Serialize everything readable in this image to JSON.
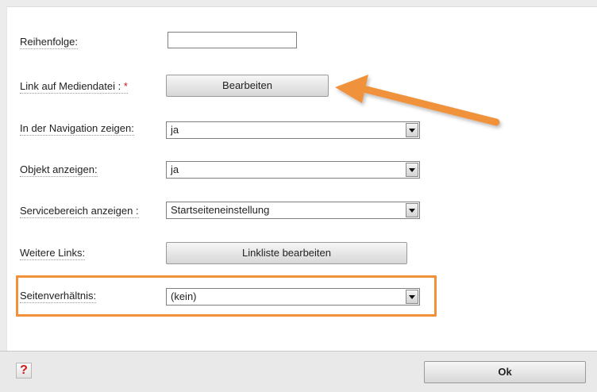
{
  "form": {
    "rows": [
      {
        "label": "Reihenfolge:",
        "type": "input",
        "value": ""
      },
      {
        "label": "Link auf Mediendatei :",
        "required_mark": "*",
        "type": "button",
        "button_label": "Bearbeiten"
      },
      {
        "label": "In der Navigation zeigen:",
        "type": "select",
        "value": "ja"
      },
      {
        "label": "Objekt anzeigen:",
        "type": "select",
        "value": "ja"
      },
      {
        "label": "Servicebereich anzeigen :",
        "type": "select",
        "value": "Startseiteneinstellung"
      },
      {
        "label": "Weitere Links:",
        "type": "button",
        "button_label": "Linkliste bearbeiten"
      },
      {
        "label": "Seitenverhältnis:",
        "type": "select",
        "value": "(kein)"
      }
    ]
  },
  "footer": {
    "help_icon_glyph": "?",
    "ok_label": "Ok"
  },
  "colors": {
    "highlight": "#f0913a",
    "annotation_arrow": "#f0913a",
    "required_mark": "#d31919"
  },
  "icons": [
    "dropdown-arrow-icon",
    "help-icon",
    "annotation-arrow"
  ]
}
